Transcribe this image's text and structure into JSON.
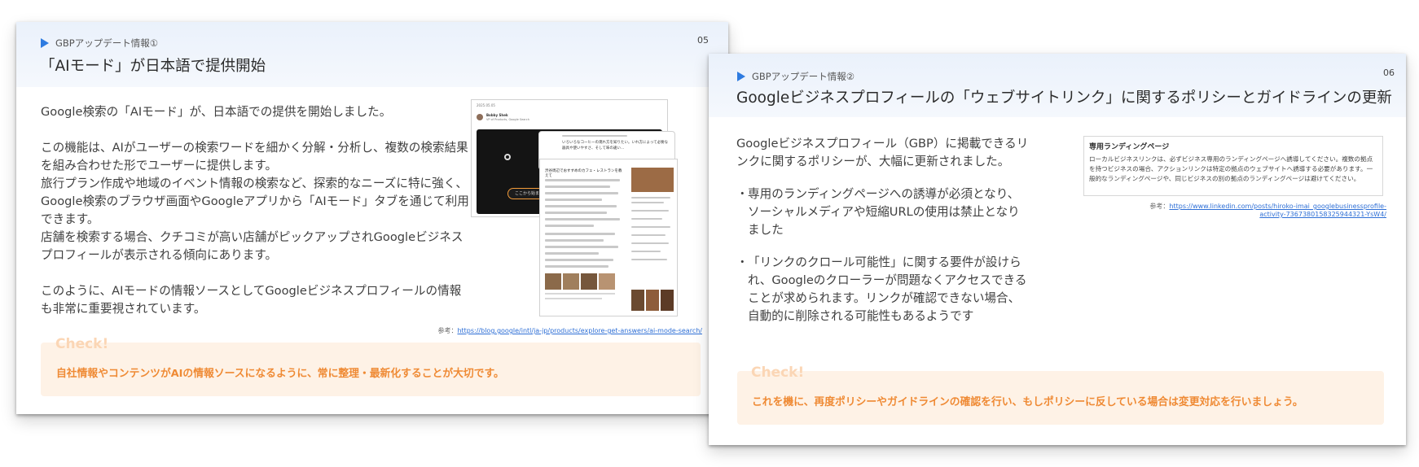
{
  "slide1": {
    "eyebrow": "GBPアップデート情報①",
    "page": "05",
    "title": "「AIモード」が日本語で提供開始",
    "paragraphs": [
      "Google検索の「AIモード」が、日本語での提供を開始しました。",
      "この機能は、AIがユーザーの検索ワードを細かく分解・分析し、複数の検索結果を組み合わせた形でユーザーに提供します。",
      "旅行プラン作成や地域のイベント情報の検索など、探索的なニーズに特に強く、Google検索のブラウザ画面やGoogleアプリから「AIモード」タブを通じて利用できます。",
      "店舗を検索する場合、クチコミが高い店舗がピックアップされGoogleビジネスプロフィールが表示される傾向にあります。",
      "このように、AIモードの情報ソースとしてGoogleビジネスプロフィールの情報も非常に重要視されています。"
    ],
    "ref_prefix": "参考：",
    "ref_link": "https://blog.google/intl/ja-jp/products/explore-get-answers/ai-mode-search/",
    "check_label": "Check!",
    "check_text": "自社情報やコンテンツがAIの情報ソースになるように、常に整理・最新化することが大切です。",
    "screenshot": {
      "date": "2025.05.05",
      "author": "Bobby Shek",
      "author_role": "VP of Products, Google Search",
      "search_pill": "ここから始まる",
      "overlay_text": "いろいろなコーヒーの淹れ方を知りたい。いれ方によって必要な器具や使いやすさ、そして味の違い…",
      "result_title": "渋谷周辺でおすすめのカフェ・レストランを教えて"
    }
  },
  "slide2": {
    "eyebrow": "GBPアップデート情報②",
    "page": "06",
    "title": "Googleビジネスプロフィールの「ウェブサイトリンク」に関するポリシーとガイドラインの更新",
    "intro": "Googleビジネスプロフィール（GBP）に掲載できるリンクに関するポリシーが、大幅に更新されました。",
    "bullets": [
      "専用のランディングページへの誘導が必須となり、ソーシャルメディアや短縮URLの使用は禁止となりました",
      "「リンクのクロール可能性」に関する要件が設けられ、Googleのクローラーが問題なくアクセスできることが求められます。リンクが確認できない場合、自動的に削除される可能性もあるようです"
    ],
    "box_heading": "専用ランディングページ",
    "box_text": "ローカルビジネスリンクは、必ずビジネス専用のランディングページへ誘導してください。複数の拠点を持つビジネスの場合、アクションリンクは特定の拠点のウェブサイトへ誘導する必要があります。一般的なランディングページや、同じビジネスの別の拠点のランディングページは避けてください。",
    "ref_prefix": "参考：",
    "ref_link_1": "https://www.linkedin.com/posts/hiroko-imai_googlebusinessprofile-",
    "ref_link_2": "activity-7367380158325944321-YsW4/",
    "check_label": "Check!",
    "check_text": "これを機に、再度ポリシーやガイドラインの確認を行い、もしポリシーに反している場合は変更対応を行いましょう。"
  },
  "colors": {
    "accent_blue": "#2e7be0",
    "check_orange": "#ef8a34",
    "check_bg": "#fef2e6",
    "header_bg": "#eaf1fb"
  }
}
